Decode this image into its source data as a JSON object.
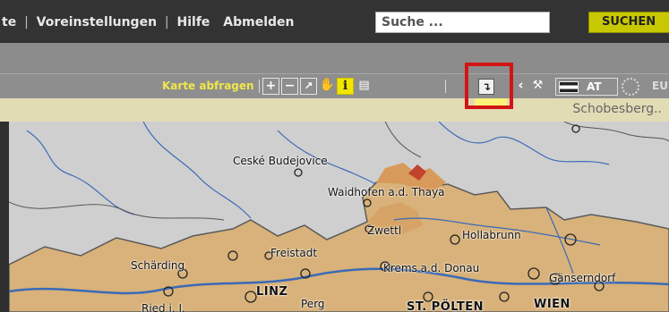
{
  "nav": {
    "items": [
      "te",
      "Voreinstellungen",
      "Hilfe",
      "Abmelden"
    ],
    "separator": "|"
  },
  "search": {
    "placeholder": "Suche ...",
    "button_label": "SUCHEN"
  },
  "toolbar": {
    "label": "Karte abfragen",
    "at_label": "AT",
    "eu_label": "EU"
  },
  "infobar": {
    "location": "Schobesberg.."
  },
  "map": {
    "cities": [
      "Ceské Budejovice",
      "Waidhofen a.d. Thaya",
      "Zwettl",
      "Hollabrunn",
      "Freistadt",
      "Schärding",
      "Krems a.d. Donau",
      "Gänserndorf",
      "LINZ",
      "Perg",
      "ST. PÖLTEN",
      "WIEN",
      "Ried i. I."
    ]
  },
  "colors": {
    "accent": "#c8c800",
    "highlight": "#d31414",
    "toolbar_label": "#f0e64a",
    "region_fill": "#d8b27a",
    "river": "#3a6ab8"
  }
}
